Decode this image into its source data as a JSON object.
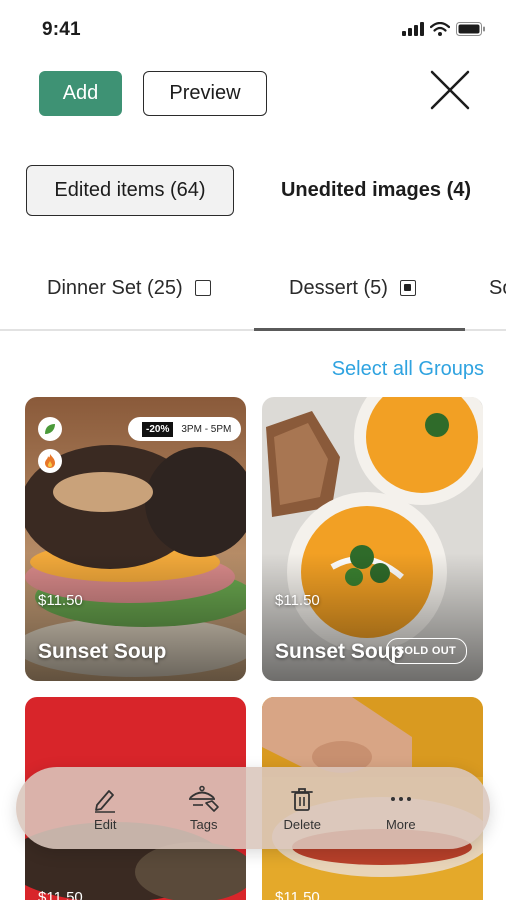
{
  "status_bar": {
    "time": "9:41"
  },
  "header": {
    "add_label": "Add",
    "preview_label": "Preview"
  },
  "segments": [
    {
      "label": "Edited items (64)",
      "active": true
    },
    {
      "label": "Unedited images (4)",
      "active": false
    }
  ],
  "category_tabs": [
    {
      "label": "Dinner Set (25)",
      "checked": false
    },
    {
      "label": "Dessert (5)",
      "checked": true,
      "active": true
    },
    {
      "label": "So"
    }
  ],
  "select_all_label": "Select all Groups",
  "cards": [
    {
      "price": "$11.50",
      "name": "Sunset Soup",
      "promo": {
        "discount": "-20%",
        "time": "3PM - 5PM"
      },
      "badges": [
        "leaf-icon",
        "fire-icon"
      ]
    },
    {
      "price": "$11.50",
      "name": "Sunset Soup",
      "status": "SOLD OUT"
    },
    {
      "price": "$11.50"
    },
    {
      "price": "$11.50"
    }
  ],
  "actions": [
    {
      "label": "Edit",
      "icon": "pencil-icon"
    },
    {
      "label": "Tags",
      "icon": "tag-icon"
    },
    {
      "label": "Delete",
      "icon": "trash-icon"
    },
    {
      "label": "More",
      "icon": "more-icon"
    }
  ],
  "colors": {
    "accent": "#3e9274",
    "link": "#2fa3e0"
  }
}
